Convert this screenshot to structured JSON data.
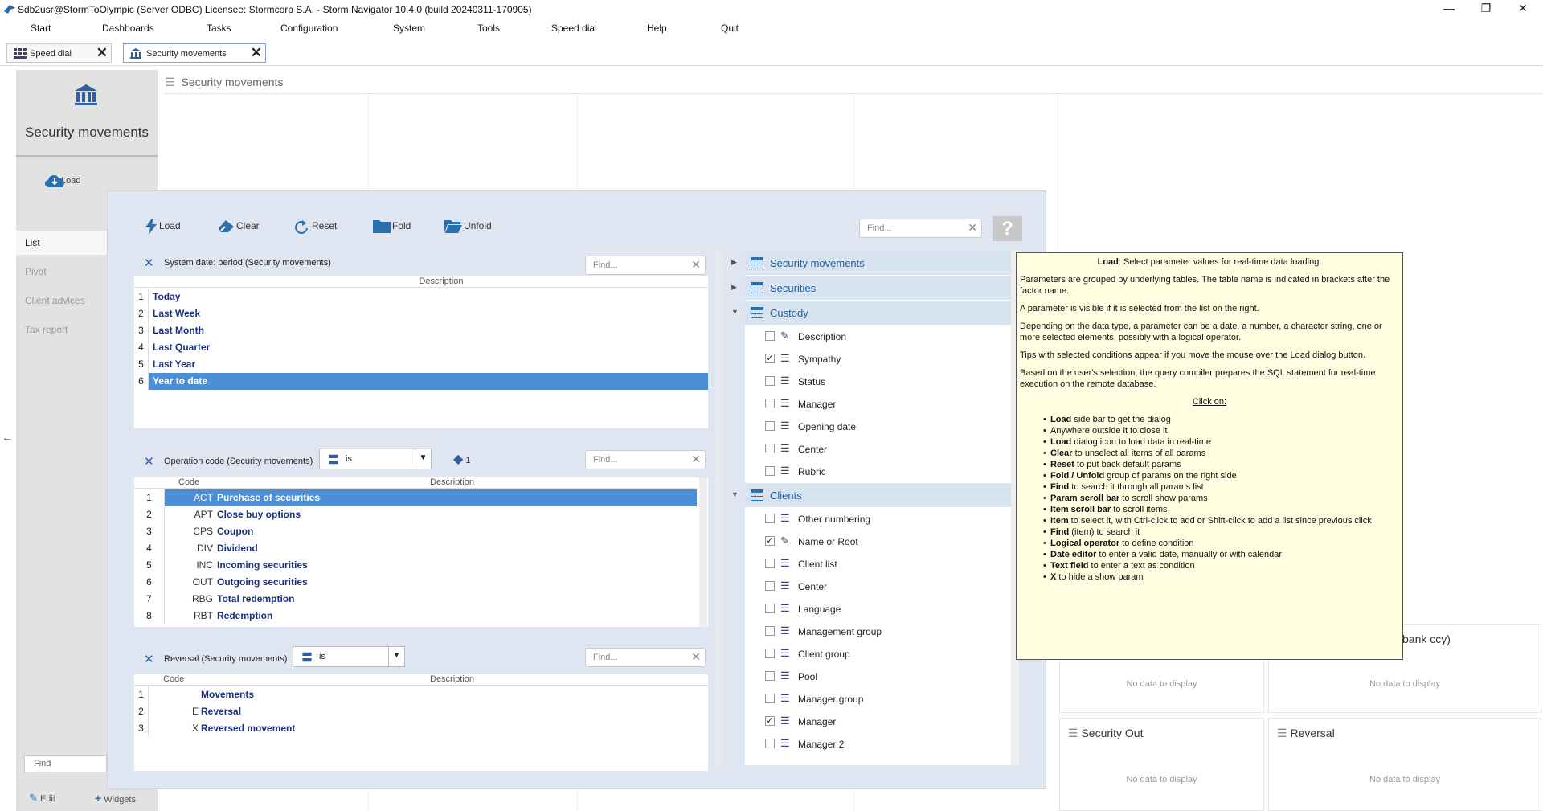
{
  "window": {
    "title": "Sdb2usr@StormToOlympic (Server ODBC)   Licensee: Stormcorp S.A. -  Storm Navigator 10.4.0 (build 20240311-170905)",
    "minimize": "—",
    "restore": "❐",
    "close": "✕"
  },
  "menu": [
    "Start",
    "Dashboards",
    "Tasks",
    "Configuration",
    "System",
    "Tools",
    "Speed dial",
    "Help",
    "Quit"
  ],
  "tabs": [
    {
      "label": "Speed dial",
      "close": "✕"
    },
    {
      "label": "Security movements",
      "close": "✕"
    }
  ],
  "sidebar": {
    "title": "Security movements",
    "load": "Load",
    "nav": [
      "List",
      "Pivot",
      "Client advices",
      "Tax report"
    ],
    "find": "Find",
    "edit": "Edit",
    "widgets": "Widgets"
  },
  "main": {
    "title": "Security movements",
    "back": "←"
  },
  "cards": [
    {
      "title": "",
      "nodata": "No data to display"
    },
    {
      "title": "bank ccy)",
      "nodata": "No data to display"
    },
    {
      "title": "Security Out",
      "nodata": "No data to display"
    },
    {
      "title": "Reversal",
      "nodata": "No data to display"
    }
  ],
  "dialog": {
    "toolbar": {
      "load": "Load",
      "clear": "Clear",
      "reset": "Reset",
      "fold": "Fold",
      "unfold": "Unfold",
      "find": "Find...",
      "help": "?"
    },
    "params": [
      {
        "title": "System date: period (Security movements)",
        "find": "Find...",
        "col_desc": "Description",
        "rows": [
          {
            "n": "1",
            "d": "Today"
          },
          {
            "n": "2",
            "d": "Last Week"
          },
          {
            "n": "3",
            "d": "Last Month"
          },
          {
            "n": "4",
            "d": "Last Quarter"
          },
          {
            "n": "5",
            "d": "Last Year"
          },
          {
            "n": "6",
            "d": "Year to date"
          }
        ]
      },
      {
        "title": "Operation code (Security movements)",
        "op": "is",
        "count": "1",
        "find": "Find...",
        "col_code": "Code",
        "col_desc": "Description",
        "rows": [
          {
            "n": "1",
            "c": "ACT",
            "d": "Purchase of securities"
          },
          {
            "n": "2",
            "c": "APT",
            "d": "Close buy options"
          },
          {
            "n": "3",
            "c": "CPS",
            "d": "Coupon"
          },
          {
            "n": "4",
            "c": "DIV",
            "d": "Dividend"
          },
          {
            "n": "5",
            "c": "INC",
            "d": "Incoming securities"
          },
          {
            "n": "6",
            "c": "OUT",
            "d": "Outgoing securities"
          },
          {
            "n": "7",
            "c": "RBG",
            "d": "Total redemption"
          },
          {
            "n": "8",
            "c": "RBT",
            "d": "Redemption"
          }
        ]
      },
      {
        "title": "Reversal (Security movements)",
        "op": "is",
        "find": "Find...",
        "col_code": "Code",
        "col_desc": "Description",
        "rows": [
          {
            "n": "1",
            "c": "",
            "d": "Movements"
          },
          {
            "n": "2",
            "c": "E",
            "d": "Reversal"
          },
          {
            "n": "3",
            "c": "X",
            "d": "Reversed movement"
          }
        ]
      }
    ],
    "groups": [
      "Security movements",
      "Securities",
      "Custody",
      "Clients"
    ],
    "custody_items": [
      {
        "l": "Description",
        "c": false
      },
      {
        "l": "Sympathy",
        "c": true
      },
      {
        "l": "Status",
        "c": false
      },
      {
        "l": "Manager",
        "c": false
      },
      {
        "l": "Opening date",
        "c": false
      },
      {
        "l": "Center",
        "c": false
      },
      {
        "l": "Rubric",
        "c": false
      }
    ],
    "clients_items": [
      {
        "l": "Other numbering",
        "c": false
      },
      {
        "l": "Name or Root",
        "c": true
      },
      {
        "l": "Client list",
        "c": false
      },
      {
        "l": "Center",
        "c": false
      },
      {
        "l": "Language",
        "c": false
      },
      {
        "l": "Management group",
        "c": false
      },
      {
        "l": "Client group",
        "c": false
      },
      {
        "l": "Pool",
        "c": false
      },
      {
        "l": "Manager group",
        "c": false
      },
      {
        "l": "Manager",
        "c": true
      },
      {
        "l": "Manager 2",
        "c": false
      }
    ]
  },
  "tooltip": {
    "p1a": "Load",
    "p1b": ": Select parameter values for real-time data loading.",
    "p2": "Parameters are grouped by underlying tables. The table name is indicated in brackets after the factor name.",
    "p3": "A parameter is visible if it is selected from the list on the right.",
    "p4": "Depending on the data type, a parameter can be a date, a number, a character string, one or more selected elements, possibly with a logical operator.",
    "p5": "Tips with selected conditions appear if you move the mouse over the Load dialog button.",
    "p6": "Based on the user's selection, the query compiler prepares the SQL statement for real-time execution on the remote database.",
    "clickon": "Click on:",
    "items": [
      {
        "b": "Load",
        "t": " side bar to get the dialog"
      },
      {
        "b": "",
        "t": "Anywhere outside it to close it"
      },
      {
        "b": "Load",
        "t": " dialog icon to load data in real-time"
      },
      {
        "b": "Clear",
        "t": " to unselect all items of all params"
      },
      {
        "b": "Reset",
        "t": " to put back default params"
      },
      {
        "b": "Fold / Unfold",
        "t": " group of params on the right side"
      },
      {
        "b": "Find",
        "t": " to search it through all params list"
      },
      {
        "b": "Param scroll bar",
        "t": " to scroll show params"
      },
      {
        "b": "Item scroll bar",
        "t": " to scroll items"
      },
      {
        "b": "Item",
        "t": " to select it, with Ctrl-click to add or Shift-click to add a list since previous click"
      },
      {
        "b": "Find",
        "t": " (item) to search it"
      },
      {
        "b": "Logical operator",
        "t": " to define condition"
      },
      {
        "b": "Date editor",
        "t": " to enter a valid date, manually or with calendar"
      },
      {
        "b": "Text field",
        "t": " to enter a text as condition"
      },
      {
        "b": "X",
        "t": " to hide a show param"
      }
    ]
  }
}
